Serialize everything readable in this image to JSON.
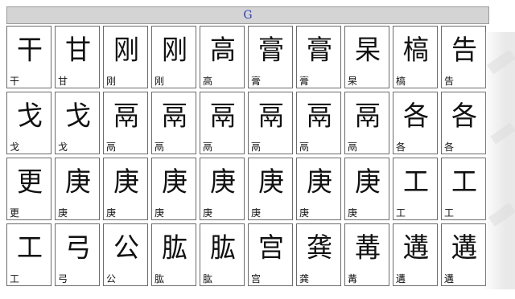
{
  "header": {
    "letter": "G"
  },
  "rows": [
    [
      {
        "glyph": "干",
        "label": "干"
      },
      {
        "glyph": "甘",
        "label": "甘"
      },
      {
        "glyph": "刚",
        "label": "刚"
      },
      {
        "glyph": "刚",
        "label": "刚"
      },
      {
        "glyph": "高",
        "label": "高"
      },
      {
        "glyph": "膏",
        "label": "膏"
      },
      {
        "glyph": "膏",
        "label": "膏"
      },
      {
        "glyph": "杲",
        "label": "杲"
      },
      {
        "glyph": "槁",
        "label": "槁"
      },
      {
        "glyph": "告",
        "label": "告"
      }
    ],
    [
      {
        "glyph": "戈",
        "label": "戈"
      },
      {
        "glyph": "戈",
        "label": "戈"
      },
      {
        "glyph": "鬲",
        "label": "鬲"
      },
      {
        "glyph": "鬲",
        "label": "鬲"
      },
      {
        "glyph": "鬲",
        "label": "鬲"
      },
      {
        "glyph": "鬲",
        "label": "鬲"
      },
      {
        "glyph": "鬲",
        "label": "鬲"
      },
      {
        "glyph": "鬲",
        "label": "鬲"
      },
      {
        "glyph": "各",
        "label": "各"
      },
      {
        "glyph": "各",
        "label": "各"
      }
    ],
    [
      {
        "glyph": "更",
        "label": "更"
      },
      {
        "glyph": "庚",
        "label": "庚"
      },
      {
        "glyph": "庚",
        "label": "庚"
      },
      {
        "glyph": "庚",
        "label": "庚"
      },
      {
        "glyph": "庚",
        "label": "庚"
      },
      {
        "glyph": "庚",
        "label": "庚"
      },
      {
        "glyph": "庚",
        "label": "庚"
      },
      {
        "glyph": "庚",
        "label": "庚"
      },
      {
        "glyph": "工",
        "label": "工"
      },
      {
        "glyph": "工",
        "label": "工"
      }
    ],
    [
      {
        "glyph": "工",
        "label": "工"
      },
      {
        "glyph": "弓",
        "label": "弓"
      },
      {
        "glyph": "公",
        "label": "公"
      },
      {
        "glyph": "肱",
        "label": "肱"
      },
      {
        "glyph": "肱",
        "label": "肱"
      },
      {
        "glyph": "宫",
        "label": "宫"
      },
      {
        "glyph": "龚",
        "label": "龚"
      },
      {
        "glyph": "冓",
        "label": "冓"
      },
      {
        "glyph": "遘",
        "label": "遘"
      },
      {
        "glyph": "遘",
        "label": "遘"
      }
    ]
  ]
}
